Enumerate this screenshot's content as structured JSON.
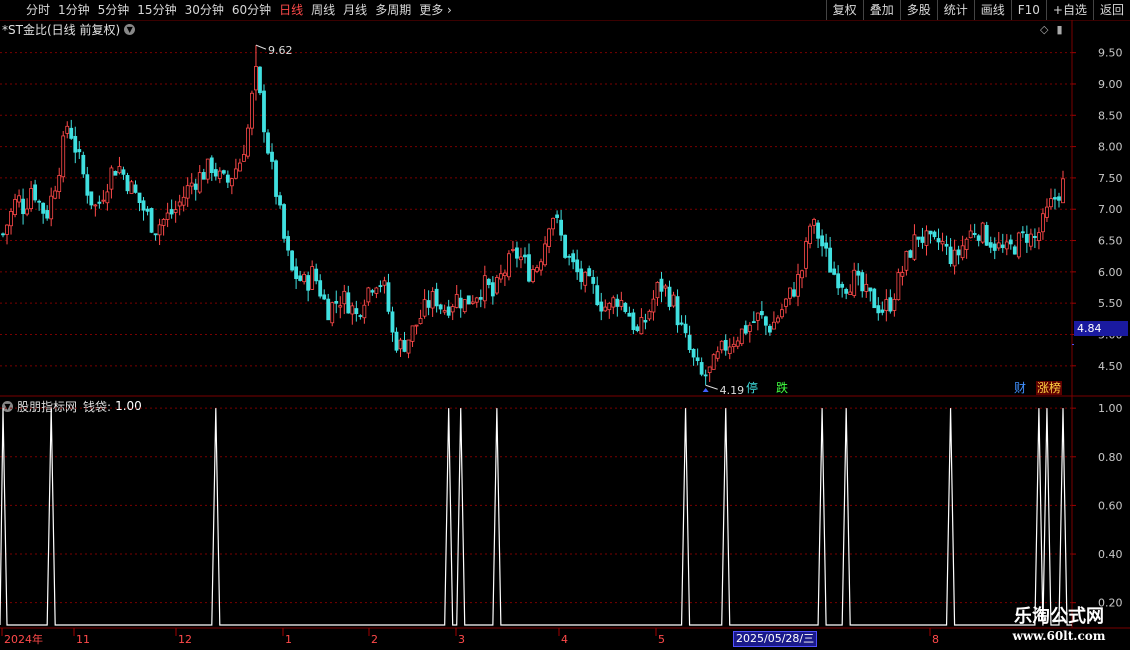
{
  "toolbar": {
    "periods": [
      "分时",
      "1分钟",
      "5分钟",
      "15分钟",
      "30分钟",
      "60分钟",
      "日线",
      "周线",
      "月线",
      "多周期"
    ],
    "active_period": "日线",
    "more": "更多",
    "right_buttons": [
      "复权",
      "叠加",
      "多股",
      "统计",
      "画线",
      "F10",
      "+自选",
      "返回"
    ]
  },
  "main_title": "*ST金比(日线 前复权)",
  "indicator_title": "股朋指标网",
  "indicator_label": "钱袋:",
  "indicator_value": "1.00",
  "current_price": "4.84",
  "high_mark": "9.62",
  "low_mark": "4.19",
  "badges": {
    "ting": "停",
    "die": "跌",
    "cai": "财",
    "zhangbang": "涨榜"
  },
  "date_label": "2025/05/28/三",
  "x_axis_labels": [
    "2024年",
    "11",
    "12",
    "1",
    "2",
    "3",
    "4",
    "5",
    "8"
  ],
  "watermark": {
    "line1": "乐淘公式网",
    "line2": "www.60lt.com"
  },
  "colors": {
    "up": "#ff4a4a",
    "down": "#40e0e0",
    "grid": "#7a0000",
    "axis_text": "#c8c8c8",
    "indicator": "#ffffff"
  },
  "chart_data": [
    {
      "type": "candlestick",
      "title": "*ST金比(日线 前复权)",
      "ylim": [
        4.05,
        9.75
      ],
      "y_ticks": [
        4.5,
        5.0,
        5.5,
        6.0,
        6.5,
        7.0,
        7.5,
        8.0,
        8.5,
        9.0,
        9.5
      ],
      "close_path": [
        6.6,
        6.9,
        7.2,
        7.0,
        7.4,
        7.1,
        6.9,
        7.3,
        7.8,
        8.4,
        8.0,
        7.6,
        7.2,
        7.0,
        7.3,
        7.6,
        7.7,
        7.5,
        7.3,
        7.1,
        6.9,
        6.7,
        6.8,
        6.9,
        7.0,
        7.2,
        7.4,
        7.5,
        7.6,
        7.7,
        7.5,
        7.4,
        7.6,
        7.8,
        8.3,
        9.2,
        8.5,
        7.8,
        7.2,
        6.5,
        6.0,
        5.9,
        5.8,
        6.0,
        5.7,
        5.4,
        5.5,
        5.6,
        5.5,
        5.3,
        5.6,
        5.8,
        5.9,
        5.7,
        5.0,
        4.8,
        4.9,
        5.1,
        5.3,
        5.5,
        5.6,
        5.4,
        5.5,
        5.6,
        5.5,
        5.6,
        5.7,
        5.8,
        5.6,
        5.9,
        6.1,
        6.3,
        6.2,
        6.0,
        6.1,
        6.4,
        7.0,
        6.7,
        6.3,
        6.1,
        5.9,
        5.8,
        5.7,
        5.5,
        5.4,
        5.6,
        5.5,
        5.3,
        5.0,
        5.2,
        5.5,
        5.8,
        5.7,
        5.5,
        5.1,
        4.8,
        4.5,
        4.3,
        4.4,
        4.6,
        4.8,
        4.9,
        5.0,
        5.1,
        5.2,
        5.3,
        5.1,
        5.2,
        5.4,
        5.6,
        5.8,
        6.1,
        6.8,
        6.6,
        6.3,
        6.0,
        5.9,
        5.8,
        5.9,
        5.7,
        5.6,
        5.5,
        5.4,
        5.5,
        5.8,
        6.1,
        6.4,
        6.6,
        6.5,
        6.4,
        6.5,
        6.3,
        6.2,
        6.4,
        6.6,
        6.7,
        6.6,
        6.5,
        6.4,
        6.3,
        6.4,
        6.5,
        6.6,
        6.5,
        6.7,
        7.0,
        7.2,
        7.4
      ],
      "high": 9.62,
      "low": 4.19
    },
    {
      "type": "line",
      "series_label": "钱袋",
      "ylim": [
        0.1,
        1.05
      ],
      "y_ticks": [
        0.2,
        0.4,
        0.6,
        0.8,
        1.0
      ],
      "spike_indices": [
        0,
        12,
        53,
        111,
        114,
        123,
        170,
        180,
        204,
        210,
        236,
        258,
        260,
        264
      ]
    }
  ]
}
